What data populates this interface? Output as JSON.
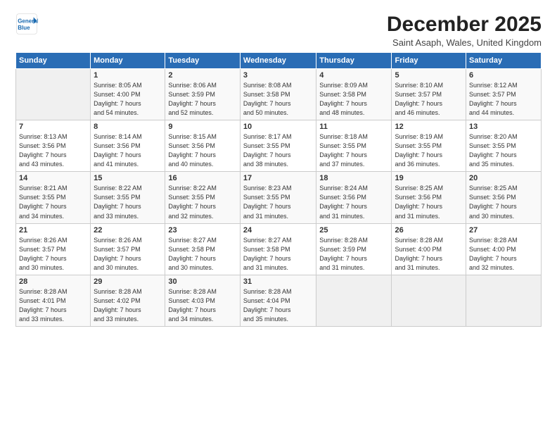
{
  "logo": {
    "line1": "General",
    "line2": "Blue"
  },
  "title": "December 2025",
  "subtitle": "Saint Asaph, Wales, United Kingdom",
  "days_of_week": [
    "Sunday",
    "Monday",
    "Tuesday",
    "Wednesday",
    "Thursday",
    "Friday",
    "Saturday"
  ],
  "weeks": [
    [
      {
        "day": "",
        "info": ""
      },
      {
        "day": "1",
        "info": "Sunrise: 8:05 AM\nSunset: 4:00 PM\nDaylight: 7 hours\nand 54 minutes."
      },
      {
        "day": "2",
        "info": "Sunrise: 8:06 AM\nSunset: 3:59 PM\nDaylight: 7 hours\nand 52 minutes."
      },
      {
        "day": "3",
        "info": "Sunrise: 8:08 AM\nSunset: 3:58 PM\nDaylight: 7 hours\nand 50 minutes."
      },
      {
        "day": "4",
        "info": "Sunrise: 8:09 AM\nSunset: 3:58 PM\nDaylight: 7 hours\nand 48 minutes."
      },
      {
        "day": "5",
        "info": "Sunrise: 8:10 AM\nSunset: 3:57 PM\nDaylight: 7 hours\nand 46 minutes."
      },
      {
        "day": "6",
        "info": "Sunrise: 8:12 AM\nSunset: 3:57 PM\nDaylight: 7 hours\nand 44 minutes."
      }
    ],
    [
      {
        "day": "7",
        "info": "Sunrise: 8:13 AM\nSunset: 3:56 PM\nDaylight: 7 hours\nand 43 minutes."
      },
      {
        "day": "8",
        "info": "Sunrise: 8:14 AM\nSunset: 3:56 PM\nDaylight: 7 hours\nand 41 minutes."
      },
      {
        "day": "9",
        "info": "Sunrise: 8:15 AM\nSunset: 3:56 PM\nDaylight: 7 hours\nand 40 minutes."
      },
      {
        "day": "10",
        "info": "Sunrise: 8:17 AM\nSunset: 3:55 PM\nDaylight: 7 hours\nand 38 minutes."
      },
      {
        "day": "11",
        "info": "Sunrise: 8:18 AM\nSunset: 3:55 PM\nDaylight: 7 hours\nand 37 minutes."
      },
      {
        "day": "12",
        "info": "Sunrise: 8:19 AM\nSunset: 3:55 PM\nDaylight: 7 hours\nand 36 minutes."
      },
      {
        "day": "13",
        "info": "Sunrise: 8:20 AM\nSunset: 3:55 PM\nDaylight: 7 hours\nand 35 minutes."
      }
    ],
    [
      {
        "day": "14",
        "info": "Sunrise: 8:21 AM\nSunset: 3:55 PM\nDaylight: 7 hours\nand 34 minutes."
      },
      {
        "day": "15",
        "info": "Sunrise: 8:22 AM\nSunset: 3:55 PM\nDaylight: 7 hours\nand 33 minutes."
      },
      {
        "day": "16",
        "info": "Sunrise: 8:22 AM\nSunset: 3:55 PM\nDaylight: 7 hours\nand 32 minutes."
      },
      {
        "day": "17",
        "info": "Sunrise: 8:23 AM\nSunset: 3:55 PM\nDaylight: 7 hours\nand 31 minutes."
      },
      {
        "day": "18",
        "info": "Sunrise: 8:24 AM\nSunset: 3:56 PM\nDaylight: 7 hours\nand 31 minutes."
      },
      {
        "day": "19",
        "info": "Sunrise: 8:25 AM\nSunset: 3:56 PM\nDaylight: 7 hours\nand 31 minutes."
      },
      {
        "day": "20",
        "info": "Sunrise: 8:25 AM\nSunset: 3:56 PM\nDaylight: 7 hours\nand 30 minutes."
      }
    ],
    [
      {
        "day": "21",
        "info": "Sunrise: 8:26 AM\nSunset: 3:57 PM\nDaylight: 7 hours\nand 30 minutes."
      },
      {
        "day": "22",
        "info": "Sunrise: 8:26 AM\nSunset: 3:57 PM\nDaylight: 7 hours\nand 30 minutes."
      },
      {
        "day": "23",
        "info": "Sunrise: 8:27 AM\nSunset: 3:58 PM\nDaylight: 7 hours\nand 30 minutes."
      },
      {
        "day": "24",
        "info": "Sunrise: 8:27 AM\nSunset: 3:58 PM\nDaylight: 7 hours\nand 31 minutes."
      },
      {
        "day": "25",
        "info": "Sunrise: 8:28 AM\nSunset: 3:59 PM\nDaylight: 7 hours\nand 31 minutes."
      },
      {
        "day": "26",
        "info": "Sunrise: 8:28 AM\nSunset: 4:00 PM\nDaylight: 7 hours\nand 31 minutes."
      },
      {
        "day": "27",
        "info": "Sunrise: 8:28 AM\nSunset: 4:00 PM\nDaylight: 7 hours\nand 32 minutes."
      }
    ],
    [
      {
        "day": "28",
        "info": "Sunrise: 8:28 AM\nSunset: 4:01 PM\nDaylight: 7 hours\nand 33 minutes."
      },
      {
        "day": "29",
        "info": "Sunrise: 8:28 AM\nSunset: 4:02 PM\nDaylight: 7 hours\nand 33 minutes."
      },
      {
        "day": "30",
        "info": "Sunrise: 8:28 AM\nSunset: 4:03 PM\nDaylight: 7 hours\nand 34 minutes."
      },
      {
        "day": "31",
        "info": "Sunrise: 8:28 AM\nSunset: 4:04 PM\nDaylight: 7 hours\nand 35 minutes."
      },
      {
        "day": "",
        "info": ""
      },
      {
        "day": "",
        "info": ""
      },
      {
        "day": "",
        "info": ""
      }
    ]
  ]
}
